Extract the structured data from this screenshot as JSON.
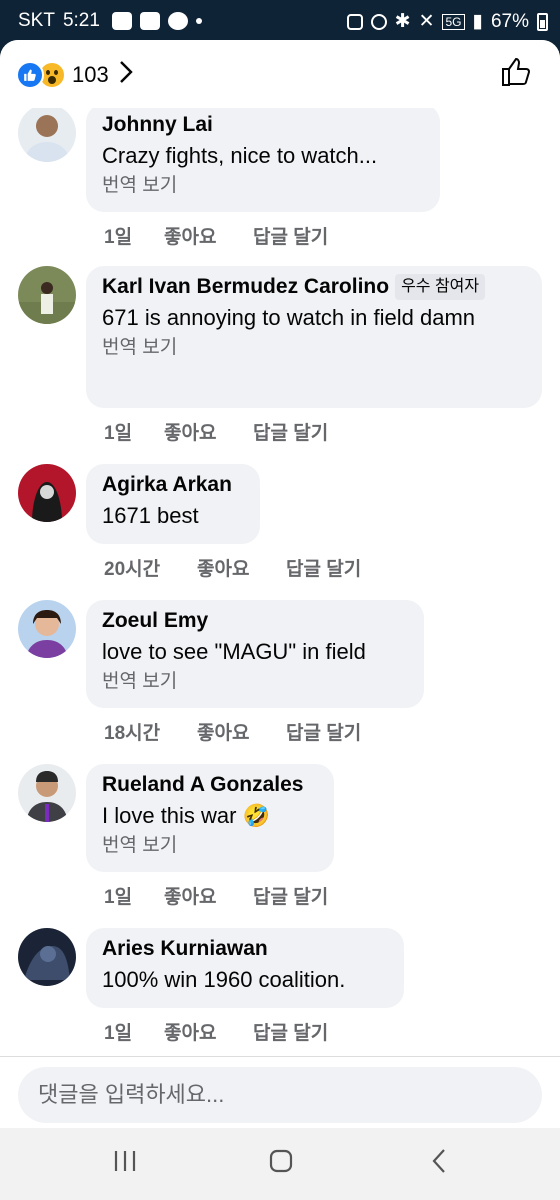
{
  "status_bar": {
    "carrier": "SKT",
    "time": "5:21",
    "network": "5G",
    "battery": "67%"
  },
  "header": {
    "reaction_count": "103",
    "reaction_icons": [
      "like-icon",
      "wow-icon"
    ]
  },
  "comments": [
    {
      "author": "Johnny Lai",
      "badge": "",
      "text": "Crazy fights, nice to watch...",
      "translate": "번역 보기",
      "time": "1일",
      "like": "좋아요",
      "reply": "답글 달기"
    },
    {
      "author": "Karl Ivan Bermudez Carolino",
      "badge": "우수 참여자",
      "text": "671 is annoying to watch in field damn",
      "translate": "번역 보기",
      "time": "1일",
      "like": "좋아요",
      "reply": "답글 달기"
    },
    {
      "author": "Agirka Arkan",
      "badge": "",
      "text": "1671 best",
      "translate": "",
      "time": "20시간",
      "like": "좋아요",
      "reply": "답글 달기"
    },
    {
      "author": "Zoeul Emy",
      "badge": "",
      "text": "love to see \"MAGU\" in field",
      "translate": "번역 보기",
      "time": "18시간",
      "like": "좋아요",
      "reply": "답글 달기"
    },
    {
      "author": "Rueland A Gonzales",
      "badge": "",
      "text": "I love this war 🤣",
      "translate": "번역 보기",
      "time": "1일",
      "like": "좋아요",
      "reply": "답글 달기"
    },
    {
      "author": "Aries Kurniawan",
      "badge": "",
      "text": "100% win 1960 coalition.",
      "translate": "",
      "time": "1일",
      "like": "좋아요",
      "reply": "답글 달기"
    }
  ],
  "input": {
    "placeholder": "댓글을 입력하세요..."
  },
  "colors": {
    "status_bar_bg": "#0f2336",
    "bubble_bg": "#f0f2f5",
    "like_blue": "#1877f2",
    "meta_gray": "#65676b"
  }
}
